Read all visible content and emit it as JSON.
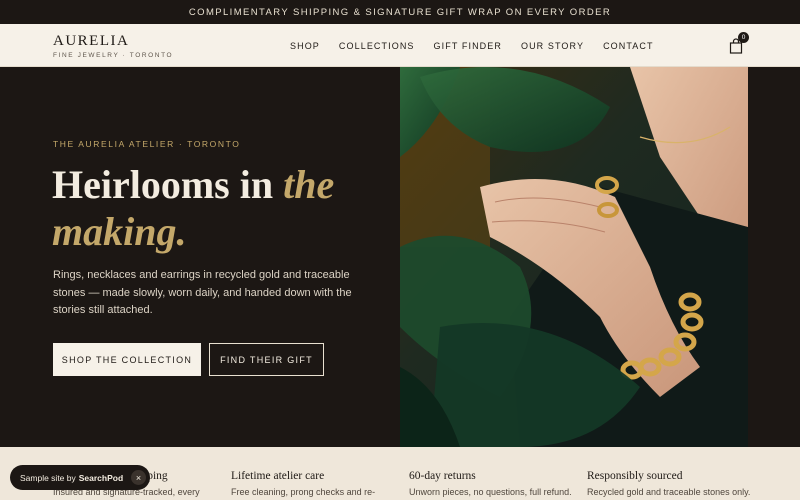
{
  "announcement": "COMPLIMENTARY SHIPPING & SIGNATURE GIFT WRAP ON EVERY ORDER",
  "brand": {
    "name": "AURELIA",
    "tagline": "FINE JEWELRY · TORONTO"
  },
  "nav": {
    "items": [
      "SHOP",
      "COLLECTIONS",
      "GIFT FINDER",
      "OUR STORY",
      "CONTACT"
    ]
  },
  "cart": {
    "icon": "shopping-bag-icon",
    "count": "0"
  },
  "hero": {
    "eyebrow": "THE AURELIA ATELIER · TORONTO",
    "headline_plain": "Heirlooms in ",
    "headline_accent": "the making.",
    "lede": "Rings, necklaces and earrings in recycled gold and traceable stones — made slowly, worn daily, and handed down with the stories still attached.",
    "primary_cta": "SHOP THE COLLECTION",
    "secondary_cta": "FIND THEIR GIFT"
  },
  "features": [
    {
      "title": "Complimentary shipping",
      "text": "Insured and signature-tracked, every"
    },
    {
      "title": "Lifetime atelier care",
      "text": "Free cleaning, prong checks and re-"
    },
    {
      "title": "60-day returns",
      "text": "Unworn pieces, no questions, full refund."
    },
    {
      "title": "Responsibly sourced",
      "text": "Recycled gold and traceable stones only."
    }
  ],
  "toast": {
    "text": "Sample site by",
    "brand": "SearchPod",
    "close": "×"
  },
  "colors": {
    "dark": "#1c1714",
    "cream": "#f6f1e8",
    "gold": "#c4a86a",
    "feature_bg": "#efe7da"
  }
}
